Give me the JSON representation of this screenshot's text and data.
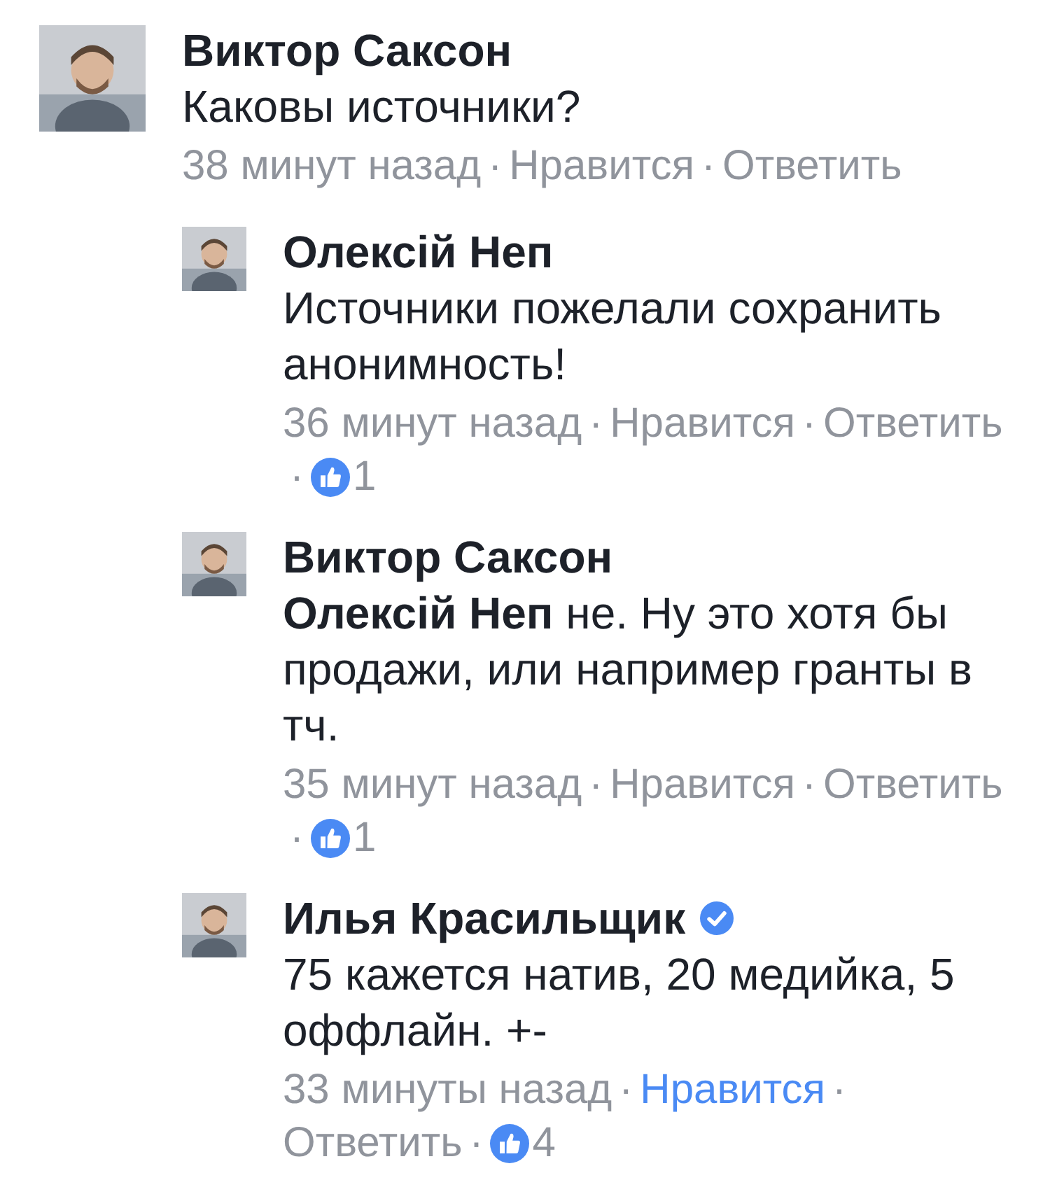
{
  "comments": [
    {
      "author": "Виктор Саксон",
      "verified": false,
      "text": "Каковы источники?",
      "time": "38 минут назад",
      "separators": [
        "·",
        "·"
      ],
      "like": "Нравится",
      "liked": false,
      "reply": "Ответить",
      "replies": [
        {
          "author": "Олексій Неп",
          "verified": false,
          "text": "Источники пожелали сохранить анонимность!",
          "time": "36 минут назад",
          "separators": [
            "·",
            "·",
            "·"
          ],
          "like": "Нравится",
          "liked": false,
          "reply": "Ответить",
          "likes": "1"
        },
        {
          "author": "Виктор Саксон",
          "verified": false,
          "text": "**Олексій Неп** не. Ну это хотя бы продажи, или например гранты в тч.",
          "time": "35 минут назад",
          "separators": [
            "·",
            "·",
            "·"
          ],
          "like": "Нравится",
          "liked": false,
          "reply": "Ответить",
          "likes": "1"
        },
        {
          "author": "Илья Красильщик",
          "verified": true,
          "text": "75 кажется натив, 20 медийка, 5 оффлайн. +-",
          "time": "33 минуты назад",
          "separators": [
            "·",
            "·",
            "·"
          ],
          "like": "Нравится",
          "liked": true,
          "reply": "Ответить",
          "likes": "4"
        }
      ]
    }
  ]
}
